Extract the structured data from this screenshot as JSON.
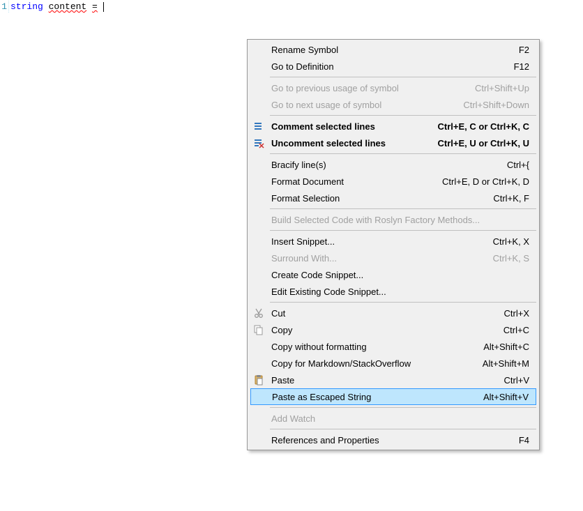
{
  "editor": {
    "line_number": "1",
    "keyword": "string",
    "identifier": "content",
    "operator": "="
  },
  "menu": {
    "items": [
      {
        "label": "Rename Symbol",
        "shortcut": "F2"
      },
      {
        "label": "Go to Definition",
        "shortcut": "F12"
      },
      "---",
      {
        "label": "Go to previous usage of symbol",
        "shortcut": "Ctrl+Shift+Up",
        "disabled": true
      },
      {
        "label": "Go to next usage of symbol",
        "shortcut": "Ctrl+Shift+Down",
        "disabled": true
      },
      "---",
      {
        "label": "Comment selected lines",
        "shortcut": "Ctrl+E, C or Ctrl+K, C",
        "bold": true,
        "icon": "comment-icon"
      },
      {
        "label": "Uncomment selected lines",
        "shortcut": "Ctrl+E, U or Ctrl+K, U",
        "bold": true,
        "icon": "uncomment-icon"
      },
      "---",
      {
        "label": "Bracify line(s)",
        "shortcut": "Ctrl+{"
      },
      {
        "label": "Format Document",
        "shortcut": "Ctrl+E, D or Ctrl+K, D"
      },
      {
        "label": "Format Selection",
        "shortcut": "Ctrl+K, F"
      },
      "---",
      {
        "label": "Build Selected Code with Roslyn Factory Methods...",
        "shortcut": "",
        "disabled": true
      },
      "---",
      {
        "label": "Insert Snippet...",
        "shortcut": "Ctrl+K, X"
      },
      {
        "label": "Surround With...",
        "shortcut": "Ctrl+K, S",
        "disabled": true
      },
      {
        "label": "Create Code Snippet..."
      },
      {
        "label": "Edit Existing Code Snippet..."
      },
      "---",
      {
        "label": "Cut",
        "shortcut": "Ctrl+X",
        "icon": "cut-icon"
      },
      {
        "label": "Copy",
        "shortcut": "Ctrl+C",
        "icon": "copy-icon"
      },
      {
        "label": "Copy without formatting",
        "shortcut": "Alt+Shift+C"
      },
      {
        "label": "Copy for Markdown/StackOverflow",
        "shortcut": "Alt+Shift+M"
      },
      {
        "label": "Paste",
        "shortcut": "Ctrl+V",
        "icon": "paste-icon"
      },
      {
        "label": "Paste as Escaped String",
        "shortcut": "Alt+Shift+V",
        "highlight": true
      },
      "---",
      {
        "label": "Add Watch",
        "disabled": true
      },
      "---",
      {
        "label": "References and Properties",
        "shortcut": "F4"
      }
    ]
  }
}
